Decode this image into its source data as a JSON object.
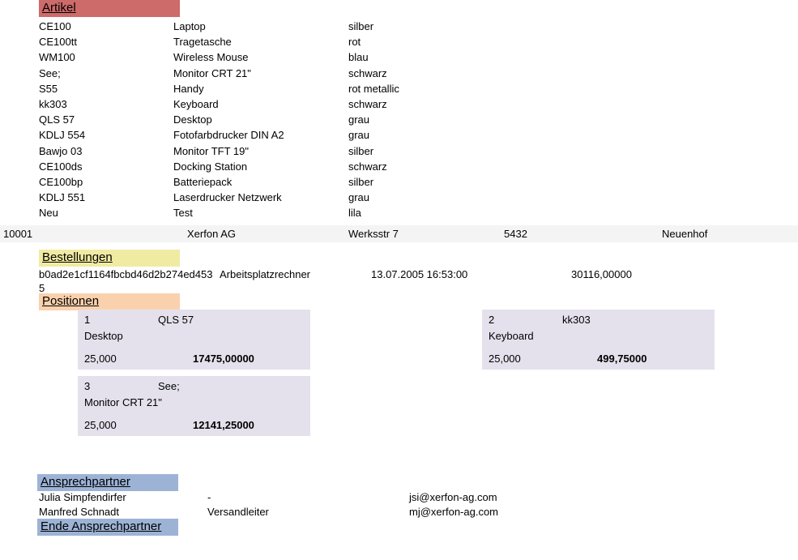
{
  "colors": {
    "artikel_bar": "#cd6a6a",
    "bestellungen_bar": "#f0eba2",
    "positionen_bar": "#fad1ad",
    "ansprechpartner_bar": "#9db3d6",
    "customer_row": "#f4f4f4",
    "position_box": "#e4e1ec"
  },
  "sections": {
    "artikel": {
      "title": "Artikel"
    },
    "bestellungen": {
      "title": "Bestellungen"
    },
    "positionen": {
      "title": "Positionen"
    },
    "ansprechpartner": {
      "title": "Ansprechpartner"
    },
    "ansprechpartner_ende": {
      "title": "Ende Ansprechpartner"
    }
  },
  "artikel": {
    "rows": [
      {
        "id": "CE100",
        "name": "Laptop",
        "color": "silber"
      },
      {
        "id": "CE100tt",
        "name": "Tragetasche",
        "color": "rot"
      },
      {
        "id": "WM100",
        "name": "Wireless Mouse",
        "color": "blau"
      },
      {
        "id": "See;",
        "name": "Monitor CRT 21\"",
        "color": "schwarz"
      },
      {
        "id": "S55",
        "name": "Handy",
        "color": "rot metallic"
      },
      {
        "id": "kk303",
        "name": "Keyboard",
        "color": "schwarz"
      },
      {
        "id": "QLS 57",
        "name": "Desktop",
        "color": "grau"
      },
      {
        "id": "KDLJ 554",
        "name": "Fotofarbdrucker DIN A2",
        "color": "grau"
      },
      {
        "id": "Bawjo 03",
        "name": "Monitor TFT 19\"",
        "color": "silber"
      },
      {
        "id": "CE100ds",
        "name": "Docking Station",
        "color": "schwarz"
      },
      {
        "id": "CE100bp",
        "name": "Batteriepack",
        "color": "silber"
      },
      {
        "id": "KDLJ 551",
        "name": "Laserdrucker Netzwerk",
        "color": "grau"
      },
      {
        "id": "Neu",
        "name": "Test",
        "color": "lila"
      }
    ]
  },
  "customer": {
    "nummer": "10001",
    "name": "Xerfon AG",
    "strasse": "Werksstr 7",
    "plz": "5432",
    "ort": "Neuenhof"
  },
  "bestellung": {
    "guid": "b0ad2e1cf1164fbcbd46d2b274ed4535",
    "bezeichnung": "Arbeitsplatzrechner",
    "datum": "13.07.2005 16:53:00",
    "summe": "30116,00000"
  },
  "positionen": [
    {
      "nummer": "1",
      "artikel": "QLS 57",
      "name": "Desktop",
      "menge": "25,000",
      "preis": "17475,00000"
    },
    {
      "nummer": "2",
      "artikel": "kk303",
      "name": "Keyboard",
      "menge": "25,000",
      "preis": "499,75000"
    },
    {
      "nummer": "3",
      "artikel": "See;",
      "name": "Monitor CRT 21\"",
      "menge": "25,000",
      "preis": "12141,25000"
    }
  ],
  "ansprechpartner": [
    {
      "name": "Julia Simpfendirfer",
      "rolle": "-",
      "email": "jsi@xerfon-ag.com"
    },
    {
      "name": "Manfred Schnadt",
      "rolle": "Versandleiter",
      "email": "mj@xerfon-ag.com"
    }
  ]
}
